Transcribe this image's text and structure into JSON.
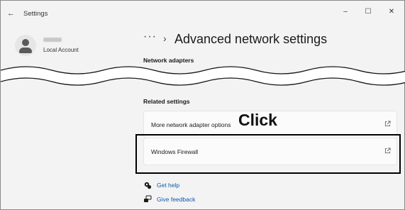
{
  "window": {
    "title": "Settings",
    "minimize_glyph": "–",
    "maximize_glyph": "☐",
    "close_glyph": "✕",
    "back_glyph": "←"
  },
  "account": {
    "type": "Local Account"
  },
  "header": {
    "breadcrumb_more": "···",
    "breadcrumb_separator": "›",
    "title": "Advanced network settings"
  },
  "sections": {
    "network_adapters": "Network adapters",
    "related_settings": "Related settings"
  },
  "related_items": [
    {
      "label": "More network adapter options",
      "icon": "open-external-icon"
    },
    {
      "label": "Windows Firewall",
      "icon": "open-external-icon"
    }
  ],
  "annotation": {
    "click_label": "Click",
    "highlight_color": "#000000"
  },
  "footer_links": [
    {
      "label": "Get help",
      "icon": "help-icon"
    },
    {
      "label": "Give feedback",
      "icon": "feedback-icon"
    }
  ],
  "colors": {
    "background": "#f3f3f3",
    "card": "#fbfbfb",
    "link": "#0b5cad"
  }
}
